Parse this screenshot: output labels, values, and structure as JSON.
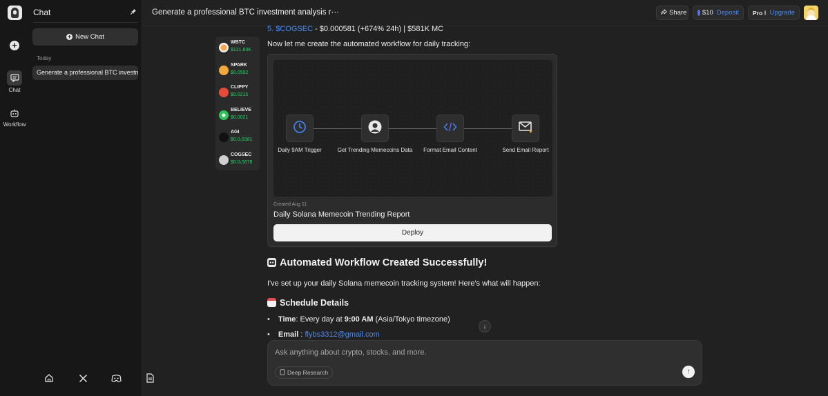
{
  "sidebar": {
    "title": "Chat",
    "new_chat_label": "New Chat",
    "section_today": "Today",
    "conversations": [
      {
        "label": "Generate a professional BTC investment analysis report"
      }
    ]
  },
  "rail": {
    "chat_label": "Chat",
    "workflow_label": "Workflow"
  },
  "header": {
    "title": "Generate a professional BTC investment analysis r···",
    "share_label": "Share",
    "balance": "$10",
    "deposit_label": "Deposit",
    "plan": "Pro",
    "upgrade_label": "Upgrade"
  },
  "tokens": [
    {
      "name": "WBTC",
      "price": "$121.83K",
      "color": "#f0f0f0",
      "icon": "wbtc-icon"
    },
    {
      "name": "SPARK",
      "price": "$0.0592",
      "color": "#f2a93b",
      "icon": "spark-icon"
    },
    {
      "name": "CLIPPY",
      "price": "$0.0215",
      "color": "#e84a3a",
      "icon": "clippy-icon"
    },
    {
      "name": "BELIEVE",
      "price": "$0.0021",
      "color": "#2fc45a",
      "icon": "believe-icon"
    },
    {
      "name": "AGI",
      "price": "$0.0₁9381",
      "color": "#111111",
      "icon": "agi-icon"
    },
    {
      "name": "COGSEC",
      "price": "$0.0₁5678",
      "color": "#cfcfcf",
      "icon": "cogsec-icon"
    }
  ],
  "content": {
    "list_item_5_link": "5. $COGSEC",
    "list_item_5_text": " - $0.000581 (+674% 24h) | $581K MC",
    "intro": "Now let me create the automated workflow for daily tracking:",
    "workflow": {
      "nodes": [
        {
          "label": "Daily 9AM Trigger",
          "icon": "clock-icon"
        },
        {
          "label": "Get Trending Memecoins Data",
          "icon": "agent-icon"
        },
        {
          "label": "Format Email Content",
          "icon": "code-icon"
        },
        {
          "label": "Send Email Report",
          "icon": "mail-icon"
        }
      ],
      "created": "Created Aug 11",
      "name": "Daily Solana Memecoin Trending Report",
      "deploy_label": "Deploy"
    },
    "heading": "Automated Workflow Created Successfully!",
    "paragraph": "I've set up your daily Solana memecoin tracking system! Here's what will happen:",
    "schedule_heading": "Schedule Details",
    "time_label": "Time",
    "time_value_pre": ": Every day at ",
    "time_value_bold": "9:00 AM",
    "time_value_post": " (Asia/Tokyo timezone)",
    "email_label": "Email",
    "email_sep": " : ",
    "email_value": "flybs3312@gmail.com"
  },
  "composer": {
    "placeholder": "Ask anything about crypto, stocks, and more.",
    "deep_research_label": "Deep Research"
  },
  "colors": {
    "accent_blue": "#4a8bf5",
    "price_green": "#37c66a",
    "icon_blue": "#3f7fe8"
  }
}
